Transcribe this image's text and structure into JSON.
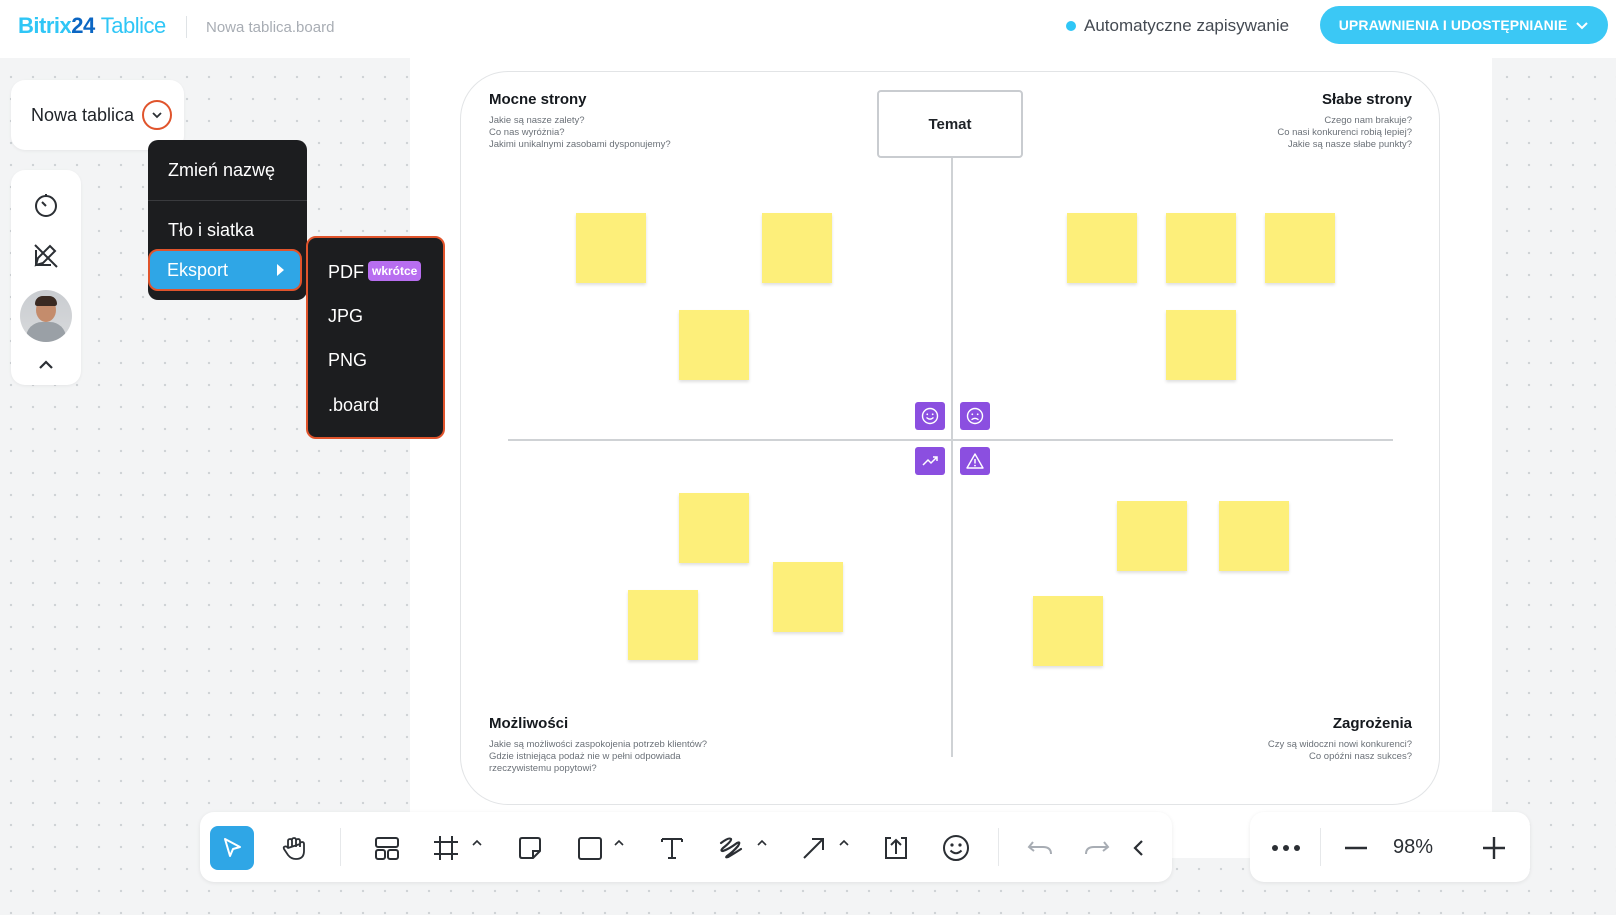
{
  "header": {
    "brand_part1": "Bitrix",
    "brand_part2": "24",
    "brand_app": "Tablice",
    "file_name": "Nowa tablica.board",
    "autosave_label": "Automatyczne zapisywanie",
    "share_button": "UPRAWNIENIA I UDOSTĘPNIANIE",
    "accent_color": "#2fc6f6"
  },
  "left_panel": {
    "board_name": "Nowa tablica",
    "tools": [
      "timer-icon",
      "pen-off-icon",
      "avatar",
      "chevron-up-icon"
    ]
  },
  "board_menu": {
    "items": [
      "Zmień nazwę",
      "Tło i siatka",
      "Eksport"
    ]
  },
  "export_submenu": {
    "items": [
      "PDF",
      "JPG",
      "PNG",
      ".board"
    ],
    "pdf_badge": "wkrótce"
  },
  "swot": {
    "topic": "Temat",
    "strengths": {
      "title": "Mocne strony",
      "desc": [
        "Jakie są nasze zalety?",
        "Co nas wyróżnia?",
        "Jakimi unikalnymi zasobami dysponujemy?"
      ]
    },
    "weaknesses": {
      "title": "Słabe strony",
      "desc": [
        "Czego nam brakuje?",
        "Co nasi konkurenci robią lepiej?",
        "Jakie są nasze słabe punkty?"
      ]
    },
    "opportunities": {
      "title": "Możliwości",
      "desc": [
        "Jakie są możliwości zaspokojenia potrzeb klientów?",
        "Gdzie istniejąca podaż nie w pełni odpowiada",
        "rzeczywistemu popytowi?"
      ]
    },
    "threats": {
      "title": "Zagrożenia",
      "desc": [
        "Czy są widoczni nowi konkurenci?",
        "Co opóźni nasz sukces?"
      ]
    },
    "sticky_color": "#fdef7a",
    "icon_color": "#8b4fe0"
  },
  "toolbar": {
    "tools": [
      "select-icon",
      "hand-icon",
      "templates-icon",
      "frame-icon",
      "sticky-note-icon",
      "shape-icon",
      "text-icon",
      "pen-icon",
      "arrow-icon",
      "upload-icon",
      "emoji-icon",
      "undo-icon",
      "redo-icon",
      "collapse-icon"
    ]
  },
  "zoom": {
    "value": "98%"
  }
}
